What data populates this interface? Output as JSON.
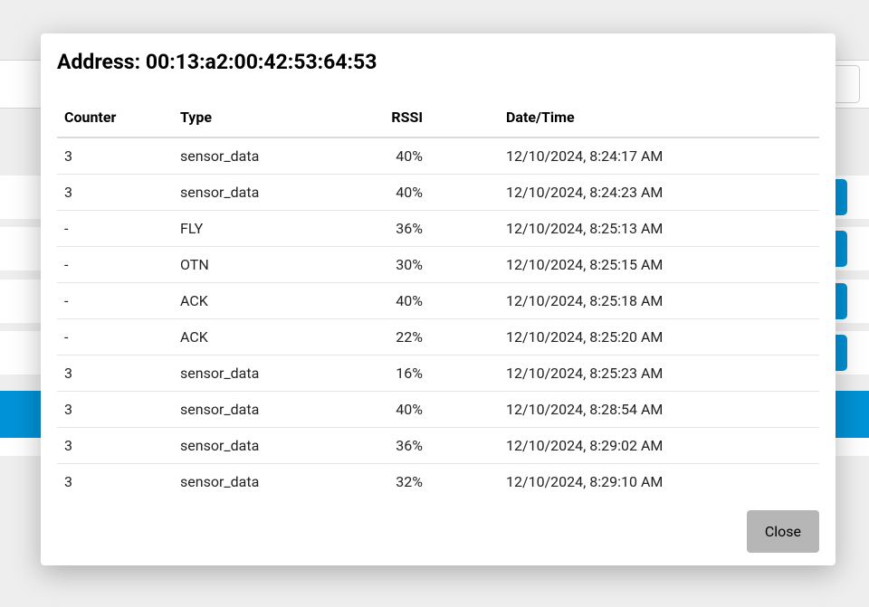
{
  "modal": {
    "title_label": "Address: ",
    "address": "00:13:a2:00:42:53:64:53",
    "close_label": "Close",
    "columns": {
      "counter": "Counter",
      "type": "Type",
      "rssi": "RSSI",
      "datetime": "Date/Time"
    },
    "rows": [
      {
        "counter": "3",
        "type": "sensor_data",
        "rssi": "40%",
        "datetime": "12/10/2024, 8:24:17 AM"
      },
      {
        "counter": "3",
        "type": "sensor_data",
        "rssi": "40%",
        "datetime": "12/10/2024, 8:24:23 AM"
      },
      {
        "counter": "-",
        "type": "FLY",
        "rssi": "36%",
        "datetime": "12/10/2024, 8:25:13 AM"
      },
      {
        "counter": "-",
        "type": "OTN",
        "rssi": "30%",
        "datetime": "12/10/2024, 8:25:15 AM"
      },
      {
        "counter": "-",
        "type": "ACK",
        "rssi": "40%",
        "datetime": "12/10/2024, 8:25:18 AM"
      },
      {
        "counter": "-",
        "type": "ACK",
        "rssi": "22%",
        "datetime": "12/10/2024, 8:25:20 AM"
      },
      {
        "counter": "3",
        "type": "sensor_data",
        "rssi": "16%",
        "datetime": "12/10/2024, 8:25:23 AM"
      },
      {
        "counter": "3",
        "type": "sensor_data",
        "rssi": "40%",
        "datetime": "12/10/2024, 8:28:54 AM"
      },
      {
        "counter": "3",
        "type": "sensor_data",
        "rssi": "36%",
        "datetime": "12/10/2024, 8:29:02 AM"
      },
      {
        "counter": "3",
        "type": "sensor_data",
        "rssi": "32%",
        "datetime": "12/10/2024, 8:29:10 AM"
      }
    ]
  }
}
